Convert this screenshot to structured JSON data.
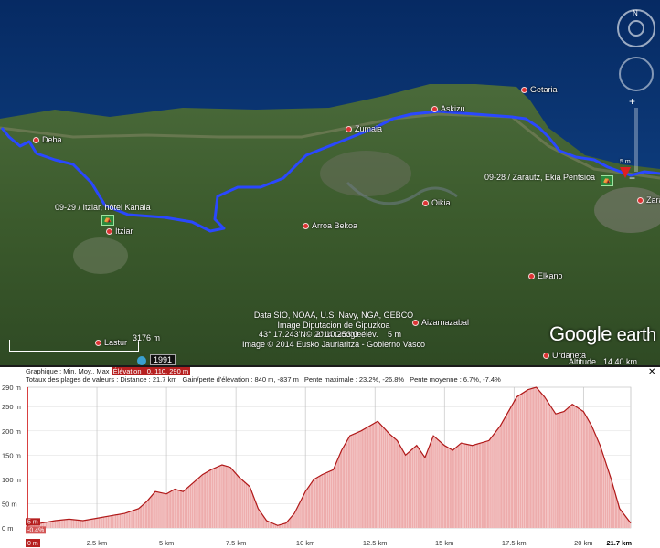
{
  "map": {
    "places": [
      {
        "name": "Deba"
      },
      {
        "name": "Zumaia"
      },
      {
        "name": "Askizu"
      },
      {
        "name": "Getaria"
      },
      {
        "name": "Oikia"
      },
      {
        "name": "Arroa Bekoa"
      },
      {
        "name": "Itziar"
      },
      {
        "name": "Aizarnazabal"
      },
      {
        "name": "Elkano"
      },
      {
        "name": "Lastur"
      },
      {
        "name": "Urdaneta"
      },
      {
        "name": "Zara"
      }
    ],
    "waypoints": [
      {
        "label": "09-29 / Itziar, hôtel Kanala"
      },
      {
        "label": "09-28 / Zarautz, Ekia Pentsioa"
      }
    ],
    "marker_label": "5 m",
    "attribution": [
      "Data SIO, NOAA, U.S. Navy, NGA, GEBCO",
      "Image Diputacion de Gipuzkoa",
      "© 2014 Google",
      "Image © 2014 Eusko Jaurlaritza - Gobierno Vasco"
    ],
    "logo": {
      "google": "Google",
      "earth": "earth"
    },
    "scale_label": "3176 m",
    "year": "1991",
    "coords": {
      "lat": "43° 17.243'N",
      "lon": "2° 10.253'O élév.",
      "elev": "5 m"
    },
    "altitude": {
      "label": "Altitude",
      "value": "14.40 km"
    },
    "route_color": "#2a48ff"
  },
  "profile": {
    "header": {
      "graph_label": "Graphique : Min, Moy., Max",
      "elevation_label": "Élévation : 0, 110, 290 m",
      "totals_label": "Totaux des plages de valeurs : Distance : 21.7 km",
      "gain_label": "Gain/perte d'élévation : 840 m, -837 m",
      "slope_max_label": "Pente maximale : 23.2%, -26.8%",
      "slope_avg_label": "Pente moyenne : 6.7%, -7.4%"
    },
    "close": "✕",
    "start_badge": "5 m",
    "start_slope": "-0.4%",
    "x_start_badge": "0 m",
    "x_end_badge": "21.7 km"
  },
  "chart_data": {
    "type": "area",
    "title": "",
    "xlabel": "",
    "ylabel": "",
    "ylim": [
      0,
      290
    ],
    "xlim": [
      0,
      21.7
    ],
    "y_ticks": [
      "0 m",
      "50 m",
      "100 m",
      "150 m",
      "200 m",
      "250 m",
      "290 m"
    ],
    "y_tick_values": [
      0,
      50,
      100,
      150,
      200,
      250,
      290
    ],
    "x_ticks": [
      "2.5 km",
      "5 km",
      "7.5 km",
      "10 km",
      "12.5 km",
      "15 km",
      "17.5 km",
      "20 km"
    ],
    "x_tick_values": [
      2.5,
      5,
      7.5,
      10,
      12.5,
      15,
      17.5,
      20
    ],
    "series": [
      {
        "x": [
          0,
          0.5,
          1,
          1.5,
          2,
          2.5,
          3,
          3.5,
          4,
          4.3,
          4.6,
          5,
          5.3,
          5.6,
          6,
          6.3,
          6.6,
          7,
          7.3,
          7.6,
          8,
          8.3,
          8.6,
          9,
          9.3,
          9.6,
          10,
          10.3,
          10.6,
          11,
          11.3,
          11.6,
          12,
          12.3,
          12.6,
          13,
          13.3,
          13.6,
          14,
          14.3,
          14.6,
          15,
          15.3,
          15.6,
          16,
          16.3,
          16.6,
          17,
          17.3,
          17.6,
          18,
          18.3,
          18.6,
          19,
          19.3,
          19.6,
          20,
          20.3,
          20.6,
          21,
          21.3,
          21.7
        ],
        "y": [
          5,
          10,
          15,
          18,
          15,
          20,
          25,
          30,
          40,
          55,
          75,
          70,
          80,
          75,
          95,
          110,
          120,
          130,
          125,
          105,
          85,
          40,
          15,
          5,
          10,
          30,
          75,
          100,
          110,
          120,
          160,
          190,
          200,
          210,
          220,
          195,
          180,
          150,
          170,
          145,
          190,
          170,
          160,
          175,
          170,
          175,
          180,
          210,
          240,
          270,
          285,
          290,
          270,
          235,
          240,
          255,
          240,
          210,
          170,
          100,
          40,
          10
        ]
      }
    ]
  }
}
